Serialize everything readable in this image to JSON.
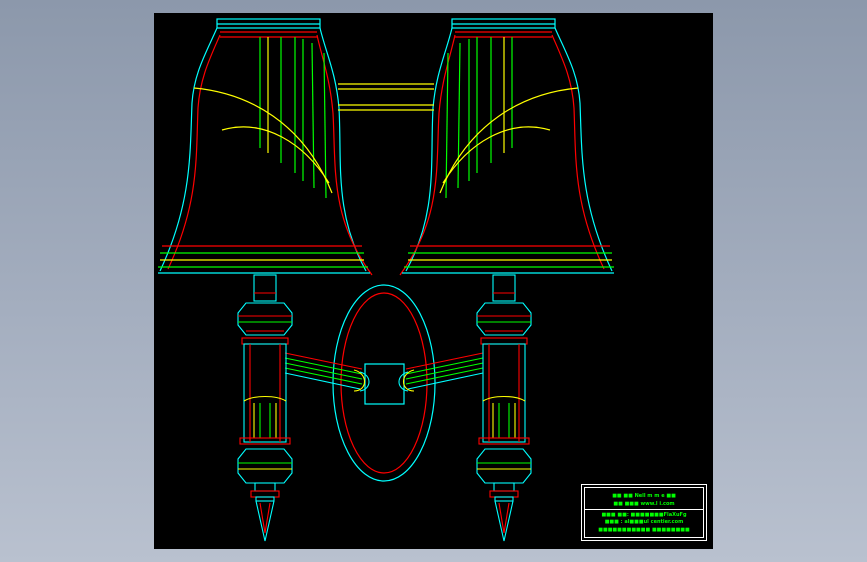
{
  "viewer": {
    "background": "#9aa5b8",
    "canvas_color": "#000000"
  },
  "drawing": {
    "subject": "twin-shade wall sconce",
    "line_colors": {
      "outline": "#00ffff",
      "shade_edge": "#ff0000",
      "ribs": "#00ff00",
      "curves": "#ffff00",
      "frame": "#ffffff"
    }
  },
  "title_block": {
    "line1": "■■ ■■  Nell  m m e  ■■",
    "line2": "■■ ■■■       www.l  i.com",
    "line3": "■■■ ■■: ■■■■■■■FlaXuFg",
    "line4": "■■■ : al■■■ul   centier.com",
    "line5": "■■■■■■■■■■■  ■■■■■■■■"
  }
}
